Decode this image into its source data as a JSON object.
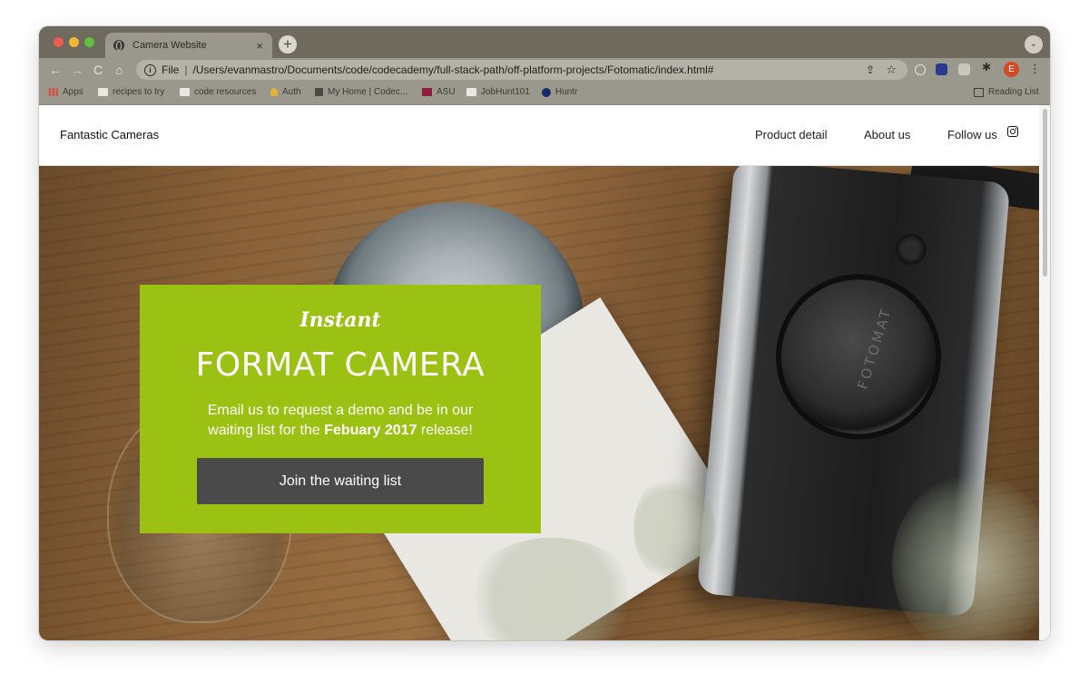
{
  "browser": {
    "tab_title": "Camera Website",
    "tab_close": "×",
    "new_tab": "+",
    "tab_menu": "⌄",
    "nav": {
      "back": "←",
      "forward": "→",
      "reload": "C",
      "home": "⌂"
    },
    "omnibox": {
      "info": "i",
      "protocol": "File",
      "separator": "|",
      "url": "/Users/evanmastro/Documents/code/codecademy/full-stack-path/off-platform-projects/Fotomatic/index.html#",
      "share": "⇪",
      "star": "☆"
    },
    "profile_initial": "E",
    "menu": "⋮",
    "puzzle": "✱",
    "bookmarks": [
      {
        "label": "Apps",
        "icon": "apps-grid-icon"
      },
      {
        "label": "recipes to try",
        "icon": "folder-icon"
      },
      {
        "label": "code resources",
        "icon": "folder-icon"
      },
      {
        "label": "Auth",
        "icon": "hand-icon"
      },
      {
        "label": "My Home | Codec...",
        "icon": "codecademy-icon"
      },
      {
        "label": "ASU",
        "icon": "asu-icon"
      },
      {
        "label": "JobHunt101",
        "icon": "folder-icon"
      },
      {
        "label": "Huntr",
        "icon": "huntr-icon"
      }
    ],
    "reading_list": "Reading List"
  },
  "site": {
    "brand": "Fantastic Cameras",
    "nav": {
      "product": "Product detail",
      "about": "About us",
      "follow": "Follow us"
    }
  },
  "promo": {
    "script_word": "Instant",
    "headline": "FORMAT CAMERA",
    "body_before": "Email us to request a demo and be in our waiting list for the ",
    "body_bold": "Febuary 2017",
    "body_after": " release!",
    "cta_label": "Join the waiting list"
  },
  "hero_image": {
    "lens_text": "FOTOMAT"
  },
  "colors": {
    "promo_green": "#9bc212",
    "cta_gray": "#4a4a4a",
    "browser_chrome": "#9a988d",
    "tab_strip": "#6e6b5e"
  }
}
